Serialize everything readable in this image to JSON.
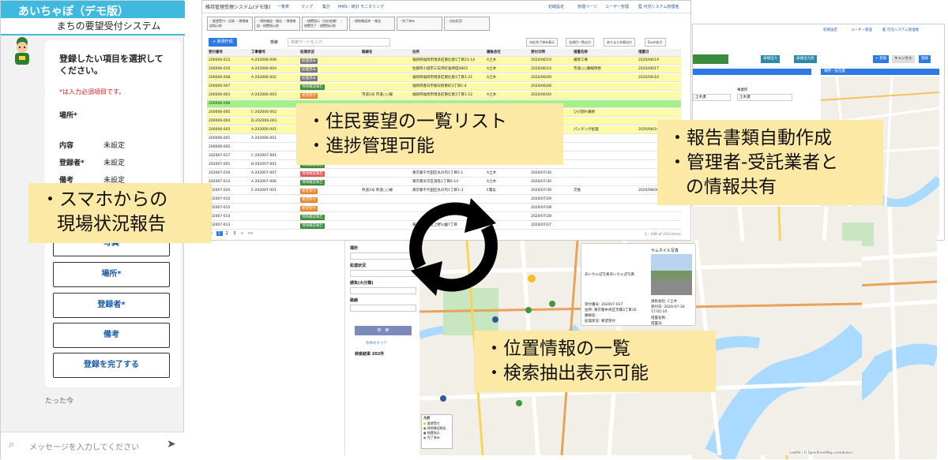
{
  "phone": {
    "title": "あいちゃぽ（デモ版）",
    "subtitle": "まちの要望受付システム",
    "prompt": "登録したい項目を選択してください。",
    "required_note": "*は入力必須項目です。",
    "place_label": "場所*",
    "fields": [
      {
        "label": "内容",
        "value": "未設定"
      },
      {
        "label": "登録者*",
        "value": "未設定"
      },
      {
        "label": "備考",
        "value": "未設定"
      }
    ],
    "buttons": [
      "写真",
      "場所*",
      "登録者*",
      "備考",
      "登録を完了する"
    ],
    "time": "たった今",
    "message_placeholder": "メッセージを入力してください"
  },
  "app": {
    "title": "維持管理受理システム(デモ版)",
    "nav": [
      "一覧表",
      "マップ",
      "集計",
      "MMS・統計",
      "モニタリング"
    ],
    "user_links": [
      "初期設定",
      "管理ページ",
      "ユーザー管理",
      "藍 可児システム管理者"
    ],
    "filters": [
      "・要望受付・記録\n・現地確認指示前",
      "・現地確認・報告\n・現地確認・措置指示前",
      "・措置指示（対応依頼）\n・措置完了・措置指示前",
      "・現地確認済\n・報告",
      "・完了済み",
      "・対応拒否"
    ],
    "new_button": "+ 新規作成",
    "search_label": "検索",
    "search_placeholder": "検索ワードを入力",
    "export_buttons": [
      "対応完了済み表示",
      "全項目一覧出力",
      "ありまとめ表出力",
      "Excel出力"
    ],
    "columns": [
      "受付番号",
      "工事番号",
      "処理状況",
      "路線名",
      "住所",
      "請負会社",
      "受付日時",
      "措置名称",
      "措置日"
    ],
    "rows": [
      {
        "id": "200006-012",
        "work": "A-202006-006",
        "status": "処理済み",
        "route": "",
        "addr": "福岡県福岡市博多区東比恵1丁目23-14",
        "co": "A土木",
        "date": "2020/06/19",
        "measure": "補修工事",
        "done": "2020/06/19",
        "bg": "#fdfba6",
        "tag": "#7a7a7a"
      },
      {
        "id": "200006-010",
        "work": "A-202006-004",
        "status": "処理済み",
        "route": "",
        "addr": "佐賀県小城市三日月町長神田4803",
        "co": "A土木",
        "date": "2020/06/14",
        "measure": "市道○○路線改修",
        "done": "2020/06/17",
        "bg": "#fdfba6",
        "tag": "#7a7a7a"
      },
      {
        "id": "200006-008",
        "work": "A-202006-002",
        "status": "処理済み",
        "route": "",
        "addr": "福岡県福岡市博多区東比恵3丁目1-21",
        "co": "A土木",
        "date": "2020/06/09",
        "measure": "",
        "done": "2020/06/10",
        "bg": "#fdfba6",
        "tag": "#7a7a7a"
      },
      {
        "id": "200006-007",
        "work": "",
        "status": "現地確認報告",
        "route": "",
        "addr": "福岡県春日市春日原東町3丁目1-4",
        "co": "",
        "date": "2020/06/08",
        "measure": "",
        "done": "",
        "bg": "#fdfba6",
        "tag": "#3c8a3c"
      },
      {
        "id": "200006-003",
        "work": "A-202006-003",
        "status": "要望受付",
        "route": "市道1号 市道○○線",
        "addr": "福岡県福岡市博多区東比恵3丁目1-12",
        "co": "A土木",
        "date": "2020/06/04",
        "measure": "",
        "done": "",
        "bg": "#fdfba6",
        "tag": "#e8852a"
      },
      {
        "id": "200006-006",
        "work": "",
        "status": "",
        "route": "",
        "addr": "",
        "co": "",
        "date": "",
        "measure": "",
        "done": "",
        "bg": "#a6f08a",
        "tag": ""
      },
      {
        "id": "200006-005",
        "work": "C-202006-002",
        "status": "処理済み",
        "route": "",
        "addr": "",
        "co": "",
        "date": "",
        "measure": "ひび割れ補修",
        "done": "",
        "bg": "#fdfba6",
        "tag": "#7a7a7a"
      },
      {
        "id": "200006-004",
        "work": "D-202006-001",
        "status": "処理済み",
        "route": "",
        "addr": "",
        "co": "",
        "date": "",
        "measure": "",
        "done": "",
        "bg": "#fdfba6",
        "tag": "#7a7a7a"
      },
      {
        "id": "200006-002",
        "work": "A-202006-001",
        "status": "処理済み",
        "route": "",
        "addr": "",
        "co": "",
        "date": "",
        "measure": "パッチング処理",
        "done": "2020/06/10",
        "bg": "#fdfba6",
        "tag": "#7a7a7a"
      },
      {
        "id": "200006-001",
        "work": "A-202006-001",
        "status": "",
        "route": "",
        "addr": "",
        "co": "",
        "date": "",
        "measure": "",
        "done": "",
        "bg": "#ffffff",
        "tag": ""
      },
      {
        "id": "200006-002",
        "work": "",
        "status": "",
        "route": "",
        "addr": "",
        "co": "",
        "date": "",
        "measure": "",
        "done": "",
        "bg": "#ffffff",
        "tag": ""
      },
      {
        "id": "202007-017",
        "work": "C-202007-001",
        "status": "",
        "route": "",
        "addr": "",
        "co": "",
        "date": "",
        "measure": "",
        "done": "",
        "bg": "#ffffff",
        "tag": ""
      },
      {
        "id": "202007-001",
        "work": "B-202007-001",
        "status": "現地確認報告",
        "route": "",
        "addr": "",
        "co": "",
        "date": "2020/07/30",
        "measure": "",
        "done": "",
        "bg": "#ffffff",
        "tag": "#3c8a3c"
      },
      {
        "id": "202007-016",
        "work": "A-202007-007",
        "status": "現地確認報告",
        "route": "",
        "addr": "東京都千代田区丸の内1丁目5-1",
        "co": "A土木",
        "date": "2020/07/30",
        "measure": "",
        "done": "",
        "bg": "#ffffff",
        "tag": "#e05a5a"
      },
      {
        "id": "202007-013",
        "work": "A-202007-006",
        "status": "現地確認報告",
        "route": "",
        "addr": "東京都文京区湯島1丁目6-14",
        "co": "A土木",
        "date": "2020/07/30",
        "measure": "",
        "done": "",
        "bg": "#ffffff",
        "tag": "#3c8a3c"
      },
      {
        "id": "202007-020",
        "work": "E-202007-001",
        "status": "要望受付",
        "route": "県道1号 県道○○線",
        "addr": "東京都千代田区丸の内1丁目1-3",
        "co": "E電気",
        "date": "2020/07/30",
        "measure": "交換",
        "done": "2020/08/06",
        "bg": "#ffffff",
        "tag": "#e8852a"
      },
      {
        "id": "202007-010",
        "work": "",
        "status": "要望受付",
        "route": "",
        "addr": "",
        "co": "",
        "date": "2020/07/29",
        "measure": "",
        "done": "",
        "bg": "#ffffff",
        "tag": "#e8852a"
      },
      {
        "id": "202007-015",
        "work": "",
        "status": "要望受付",
        "route": "",
        "addr": "",
        "co": "",
        "date": "2020/07/28",
        "measure": "",
        "done": "",
        "bg": "#ffffff",
        "tag": "#e8852a"
      },
      {
        "id": "202007-014",
        "work": "",
        "status": "現地確認報告",
        "route": "",
        "addr": "",
        "co": "",
        "date": "2020/07/28",
        "measure": "",
        "done": "",
        "bg": "#ffffff",
        "tag": "#3c8a3c"
      },
      {
        "id": "202007-013",
        "work": "",
        "status": "現地確認報告",
        "route": "",
        "addr": "東京都台東区上野公園7丁目",
        "co": "",
        "date": "2020/07/27",
        "measure": "",
        "done": "",
        "bg": "#ffffff",
        "tag": "#3c8a3c"
      }
    ],
    "pager": [
      "«",
      "1",
      "2",
      "3",
      "»",
      "»»"
    ],
    "pager_info": "1 - 100 of 210 items"
  },
  "right_app": {
    "user_links": [
      "初期設定",
      "ユーザー管理",
      "藍 可児システム管理者"
    ],
    "buttons": [
      "表検出力",
      "表検出力詳",
      "+ 登録",
      "キャンセル",
      "登録"
    ],
    "panel_title": "場所・拡位置",
    "field_label": "事業所",
    "field_value": "土木課",
    "field2_value": "土木課"
  },
  "map_panel": {
    "fields": [
      "場所",
      "処理状況",
      "請負(大分類)",
      "路線"
    ],
    "search_button": "検　索",
    "clear_link": "条件のクリア",
    "result": "検索結果 202件"
  },
  "popup": {
    "tag": "サムネイル写真",
    "photo_label": "あいちゃぽ写真あいちゃぽ写真",
    "lines": [
      "受付番号: 202007-017",
      "住所: 東京都中央区京橋3丁目16",
      "路線名:",
      "処理状況: 要望受付"
    ],
    "right_lines": [
      "請負会社: C土木",
      "受付日: 2020-07-30",
      "17:02:10",
      "措置名称:",
      "措置日:"
    ]
  },
  "legend": {
    "title": "凡例",
    "items": [
      {
        "label": "要望受付",
        "color": "#f0c21a"
      },
      {
        "label": "現地確認報告",
        "color": "#3c9a3c"
      },
      {
        "label": "措置指示",
        "color": "#2c5b9a"
      },
      {
        "label": "完了済み",
        "color": "#888888"
      }
    ]
  },
  "map_attribution": "Leaflet | © OpenStreetMap contributors",
  "callouts": {
    "phone": [
      "・スマホからの",
      "現場状況報告"
    ],
    "list": [
      "・住民要望の一覧リスト",
      "・進捗管理可能"
    ],
    "report": [
      "・報告書類自動作成",
      "・管理者-受託業者と",
      "の情報共有"
    ],
    "map": [
      "・位置情報の一覧",
      "・検索抽出表示可能"
    ]
  },
  "colors": {
    "phone_header": "#3fb9e0",
    "callout": "#fde9a6",
    "highlight_yellow": "#fdfba6",
    "highlight_green": "#a6f08a",
    "accent": "#2c5b9a"
  }
}
